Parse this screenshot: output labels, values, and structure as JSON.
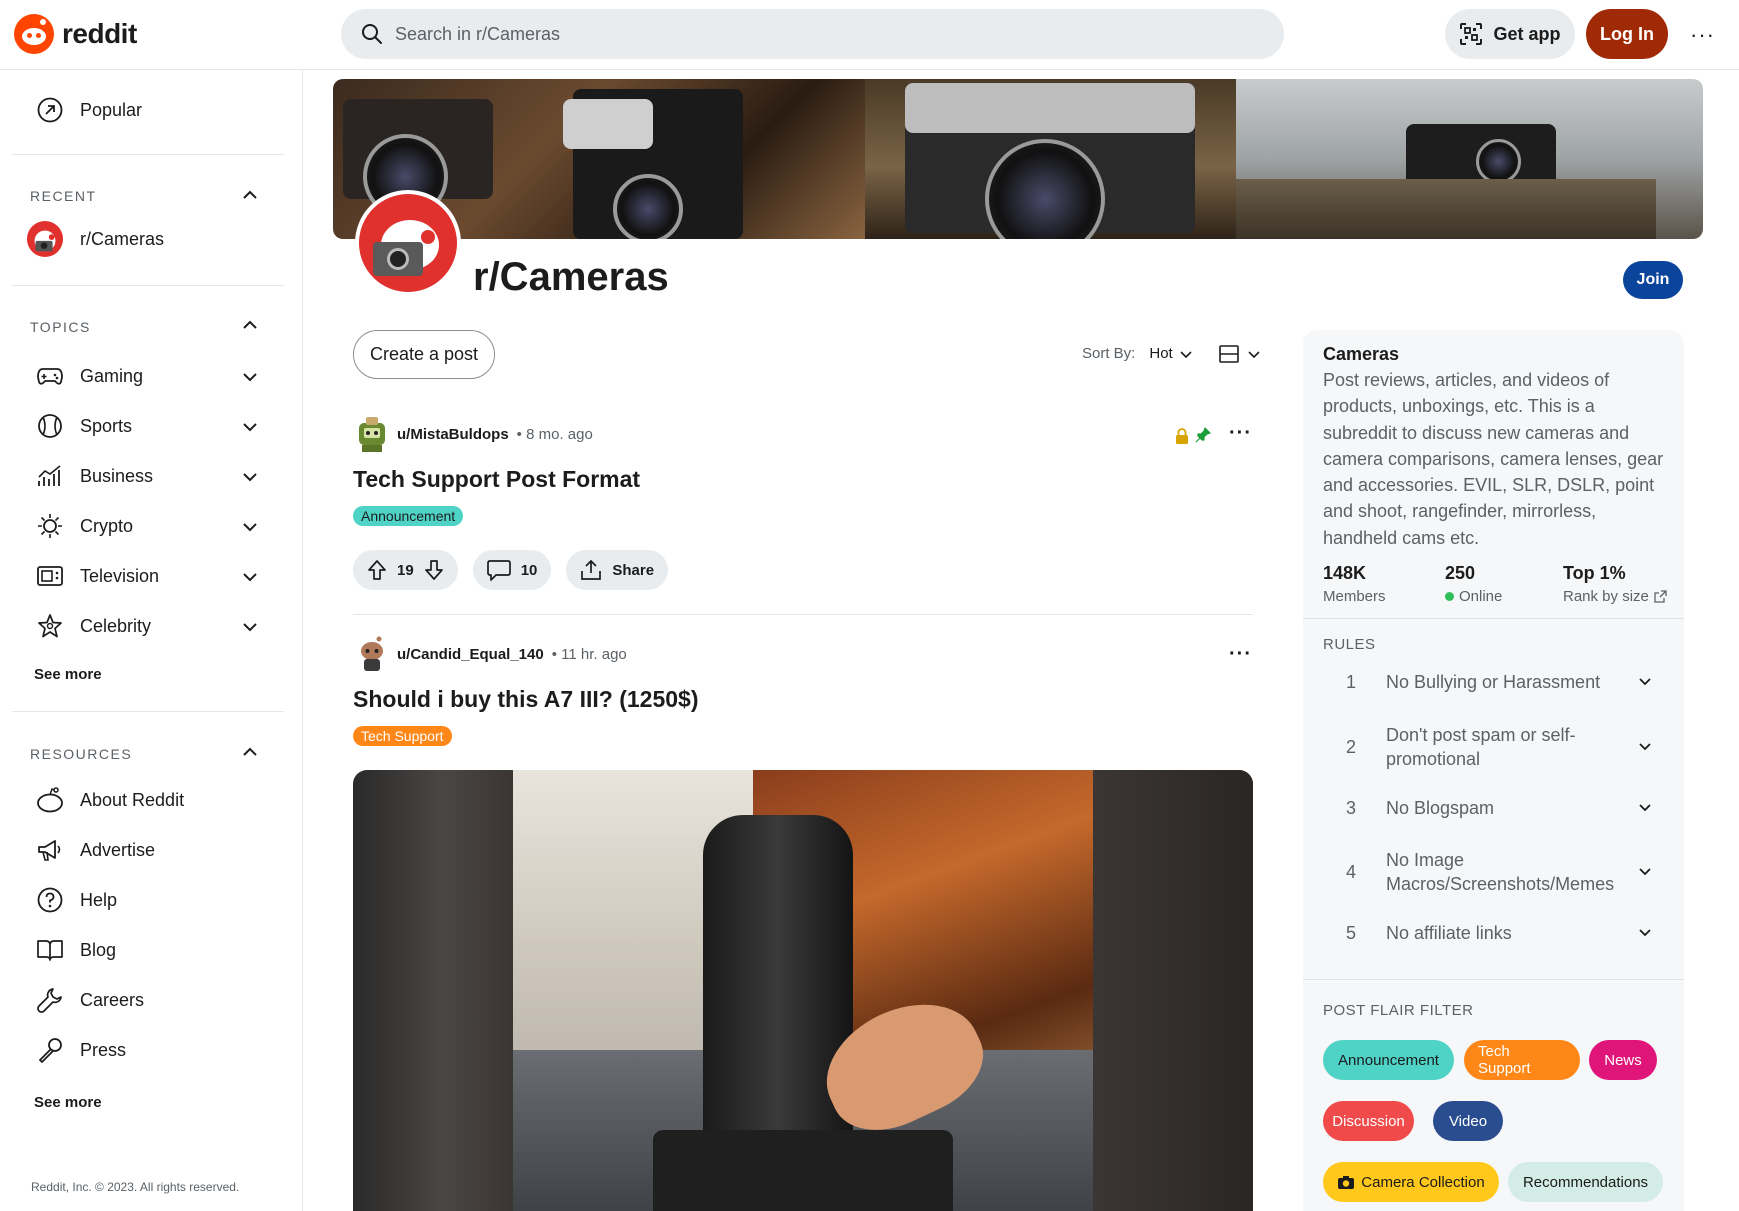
{
  "header": {
    "logo_text": "reddit",
    "search_placeholder": "Search in r/Cameras",
    "get_app": "Get app",
    "login": "Log In",
    "more": "···"
  },
  "sidebar": {
    "popular": "Popular",
    "recent_heading": "RECENT",
    "recent_items": [
      "r/Cameras"
    ],
    "topics_heading": "TOPICS",
    "topics": [
      "Gaming",
      "Sports",
      "Business",
      "Crypto",
      "Television",
      "Celebrity"
    ],
    "topics_see_more": "See more",
    "resources_heading": "RESOURCES",
    "resources": [
      "About Reddit",
      "Advertise",
      "Help",
      "Blog",
      "Careers",
      "Press"
    ],
    "resources_see_more": "See more",
    "copyright": "Reddit, Inc. © 2023. All rights reserved."
  },
  "subreddit": {
    "name": "r/Cameras",
    "join": "Join"
  },
  "feed": {
    "create_post": "Create a post",
    "sort_label": "Sort By:",
    "sort_value": "Hot",
    "posts": [
      {
        "author": "u/MistaBuldops",
        "time": "• 8 mo. ago",
        "title": "Tech Support Post Format",
        "flair": "Announcement",
        "upvotes": "19",
        "comments": "10",
        "share": "Share"
      },
      {
        "author": "u/Candid_Equal_140",
        "time": "• 11 hr. ago",
        "title": "Should i buy this A7 III? (1250$)",
        "flair": "Tech Support"
      }
    ]
  },
  "about": {
    "title": "Cameras",
    "description": "Post reviews, articles, and videos of products, unboxings, etc. This is a subreddit to discuss new cameras and camera comparisons, camera lenses, gear and accessories. EVIL, SLR, DSLR, point and shoot, rangefinder, mirrorless, handheld cams etc.",
    "stats": [
      {
        "value": "148K",
        "label": "Members"
      },
      {
        "value": "250",
        "label": "Online"
      },
      {
        "value": "Top 1%",
        "label": "Rank by size"
      }
    ],
    "rules_heading": "RULES",
    "rules": [
      {
        "num": "1",
        "text": "No Bullying or Harassment"
      },
      {
        "num": "2",
        "text": "Don't post spam or self-promotional"
      },
      {
        "num": "3",
        "text": "No Blogspam"
      },
      {
        "num": "4",
        "text": "No Image Macros/Screenshots/Memes"
      },
      {
        "num": "5",
        "text": "No affiliate links"
      }
    ],
    "flair_heading": "POST FLAIR FILTER",
    "flairs": [
      "Announcement",
      "Tech Support",
      "News",
      "Discussion",
      "Video",
      "Camera Collection",
      "Recommendations"
    ]
  },
  "colors": {
    "brand": "#ff4500",
    "login_bg": "#a12a06",
    "join_bg": "#0a449b",
    "flair_announcement": "#4ed3c6",
    "flair_tech_support": "#ff8717",
    "flair_news": "#e0157a",
    "flair_discussion": "#f04a4a",
    "flair_video": "#2a4d8f",
    "flair_camera_collection": "#ffc81a",
    "flair_recommendations": "#d3ece5"
  }
}
